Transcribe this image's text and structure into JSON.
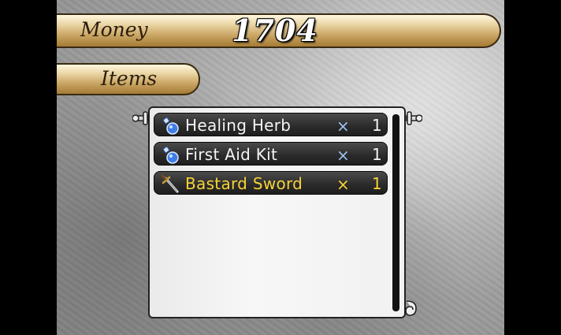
{
  "header": {
    "money_label": "Money",
    "money_value": "1704",
    "items_label": "Items"
  },
  "inventory": {
    "items": [
      {
        "name": "Healing Herb",
        "times": "×",
        "qty": "1",
        "icon": "potion-icon",
        "selected": false
      },
      {
        "name": "First Aid Kit",
        "times": "×",
        "qty": "1",
        "icon": "potion-icon",
        "selected": false
      },
      {
        "name": "Bastard Sword",
        "times": "×",
        "qty": "1",
        "icon": "sword-icon",
        "selected": true
      }
    ]
  },
  "colors": {
    "selected_text": "#f6d338",
    "normal_text": "#f4f4f4",
    "plate_gold": "#c9a462"
  }
}
